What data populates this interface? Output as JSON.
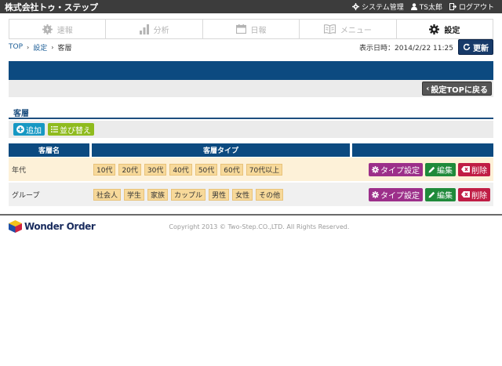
{
  "header": {
    "company": "株式会社トゥ・ステップ",
    "links": [
      {
        "icon": "gear-icon",
        "label": "システム管理"
      },
      {
        "icon": "user-icon",
        "label": "TS太郎"
      },
      {
        "icon": "logout-icon",
        "label": "ログアウト"
      }
    ]
  },
  "nav": {
    "items": [
      {
        "icon": "bolt-gear-icon",
        "label": "速報"
      },
      {
        "icon": "bar-chart-icon",
        "label": "分析"
      },
      {
        "icon": "calendar-icon",
        "label": "日報"
      },
      {
        "icon": "book-icon",
        "label": "メニュー"
      },
      {
        "icon": "gear-icon",
        "label": "設定"
      }
    ],
    "active": "設定"
  },
  "breadcrumb": {
    "items": [
      "TOP",
      "設定",
      "客層"
    ],
    "separator": "›"
  },
  "display_time": "表示日時：2014/2/22 11:25",
  "refresh_label": "更新",
  "back_label": "設定TOPに戻る",
  "section_title": "客層",
  "toolbar": {
    "add_label": "追加",
    "sort_label": "並び替え"
  },
  "table": {
    "headers": [
      "客層名",
      "客層タイプ",
      ""
    ],
    "rows": [
      {
        "name": "年代",
        "types": [
          "10代",
          "20代",
          "30代",
          "40代",
          "50代",
          "60代",
          "70代以上"
        ]
      },
      {
        "name": "グループ",
        "types": [
          "社会人",
          "学生",
          "家族",
          "カップル",
          "男性",
          "女性",
          "その他"
        ]
      }
    ],
    "actions": {
      "type": "タイプ設定",
      "edit": "編集",
      "delete": "削除"
    }
  },
  "footer": {
    "logo": "Wonder Order",
    "copyright": "Copyright 2013 © Two-Step.CO.,LTD. All Rights Reserved."
  },
  "colors": {
    "nav_bar": "#0c4a80",
    "accent_blue": "#1798c3",
    "accent_green": "#8fbb1e",
    "type_button": "#9c2f8a",
    "edit_button": "#1f8a3a",
    "delete_button": "#c01d45",
    "tag": "#f7d99a"
  }
}
